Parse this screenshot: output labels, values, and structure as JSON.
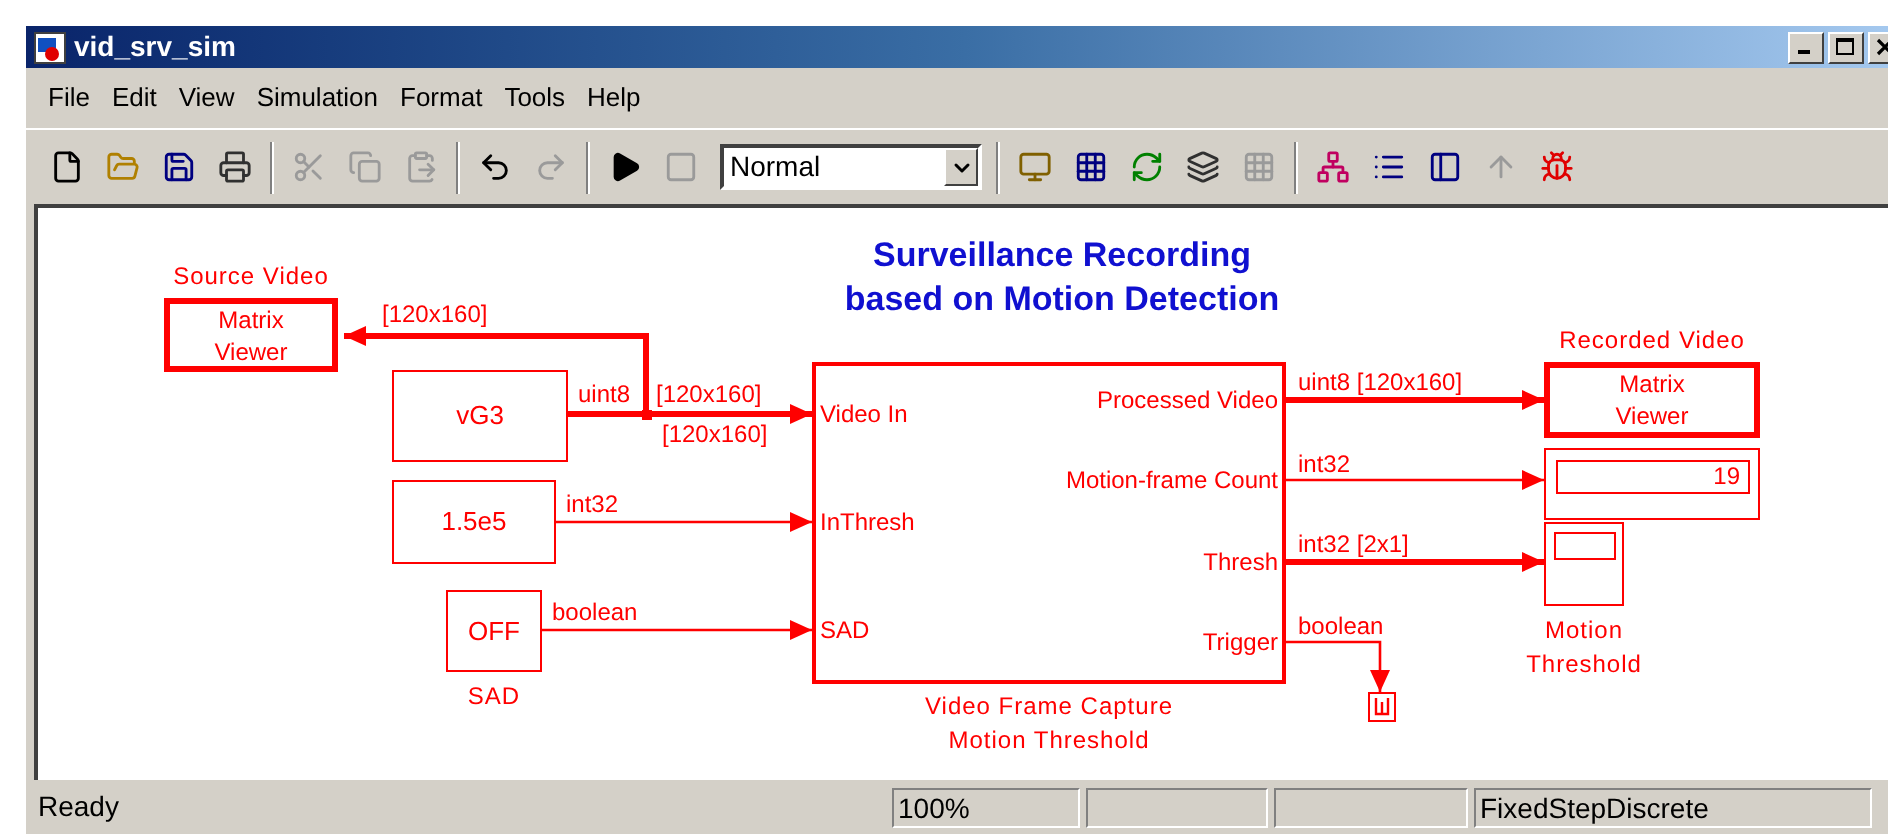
{
  "window": {
    "title": "vid_srv_sim"
  },
  "menu": [
    "File",
    "Edit",
    "View",
    "Simulation",
    "Format",
    "Tools",
    "Help"
  ],
  "toolbar": {
    "buttons": [
      {
        "disabled": false
      },
      {
        "disabled": false
      },
      {
        "disabled": false
      },
      {
        "disabled": false
      },
      {
        "disabled": true
      },
      {
        "disabled": true
      },
      {
        "disabled": true
      },
      {
        "disabled": false
      },
      {
        "disabled": true
      },
      {
        "disabled": false
      },
      {
        "disabled": true
      }
    ],
    "mode": "Normal",
    "tools": [
      {
        "disabled": false
      },
      {
        "disabled": false
      },
      {
        "disabled": false
      },
      {
        "disabled": false
      },
      {
        "disabled": true
      },
      {
        "disabled": false
      },
      {
        "disabled": false
      },
      {
        "disabled": false
      },
      {
        "disabled": true
      },
      {
        "disabled": false
      }
    ]
  },
  "diagram": {
    "title": [
      "Surveillance Recording",
      "based on Motion Detection"
    ],
    "blocks": [
      {
        "kind": "viewer",
        "label": [
          "Matrix",
          "Viewer"
        ],
        "caption": [
          "Source Video"
        ]
      },
      {
        "kind": "source",
        "label": [
          "vG3"
        ]
      },
      {
        "kind": "constant",
        "label": [
          "1.5e5"
        ]
      },
      {
        "kind": "constant",
        "label": [
          "OFF"
        ],
        "caption": [
          "SAD"
        ]
      },
      {
        "kind": "subsystem",
        "inputs": [
          "Video In",
          "InThresh",
          "SAD"
        ],
        "outputs": [
          "Processed Video",
          "Motion-frame Count",
          "Thresh",
          "Trigger"
        ],
        "caption": [
          "Video Frame Capture",
          "Motion Threshold"
        ]
      },
      {
        "kind": "viewer",
        "label": [
          "Matrix",
          "Viewer"
        ],
        "caption": [
          "Recorded Video"
        ]
      },
      {
        "kind": "display",
        "value": "19"
      },
      {
        "kind": "scope",
        "caption": [
          "Motion",
          "Threshold"
        ]
      },
      {
        "kind": "terminator"
      }
    ],
    "signals": [
      {
        "labels": [
          "uint8",
          "[120x160]",
          "[120x160]"
        ],
        "wide": true
      },
      {
        "labels": [
          "[120x160]"
        ],
        "wide": true
      },
      {
        "labels": [
          "int32"
        ],
        "wide": false
      },
      {
        "labels": [
          "boolean"
        ],
        "wide": false
      },
      {
        "labels": [
          "uint8 [120x160]"
        ],
        "wide": true
      },
      {
        "labels": [
          "int32"
        ],
        "wide": false
      },
      {
        "labels": [
          "int32 [2x1]"
        ],
        "wide": true
      },
      {
        "labels": [
          "boolean"
        ],
        "wide": false
      }
    ]
  },
  "status_bar": {
    "state": "Ready",
    "zoom": "100%",
    "solver": "FixedStepDiscrete"
  }
}
